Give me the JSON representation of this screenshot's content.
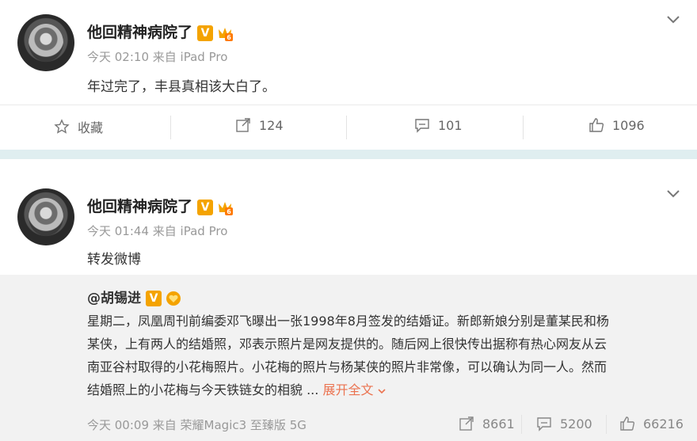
{
  "post1": {
    "author": "他回精神病院了",
    "v_badge": "V",
    "time": "今天 02:10",
    "source": "来自 iPad Pro",
    "text": "年过完了，丰县真相该大白了。",
    "actions": {
      "favorite_label": "收藏",
      "repost_count": "124",
      "comment_count": "101",
      "like_count": "1096"
    }
  },
  "post2": {
    "author": "他回精神病院了",
    "v_badge": "V",
    "time": "今天 01:44",
    "source": "来自 iPad Pro",
    "text": "转发微博",
    "quoted": {
      "author": "@胡锡进",
      "v_badge": "V",
      "lines": [
        "星期二，凤凰周刊前编委邓飞曝出一张1998年8月签发的结婚证。新郎新娘分别是董某民和杨",
        "某侠，上有两人的结婚照，邓表示照片是网友提供的。随后网上很快传出据称有热心网友从云",
        "南亚谷村取得的小花梅照片。小花梅的照片与杨某侠的照片非常像，可以确认为同一人。然而",
        "结婚照上的小花梅与今天铁链女的相貌 ..."
      ],
      "expand_label": "展开全文",
      "time": "今天 00:09",
      "source": "来自 荣耀Magic3 至臻版 5G",
      "repost_count": "8661",
      "comment_count": "5200",
      "like_count": "66216"
    }
  },
  "colors": {
    "accent": "#eb7350",
    "v_badge": "#f4a300",
    "separator_band": "#dfeef0",
    "quote_bg": "#f2f2f2"
  },
  "icons": [
    "chevron-down-icon",
    "star-icon",
    "repost-icon",
    "comment-icon",
    "thumbs-up-icon",
    "vip-badge-icon"
  ]
}
